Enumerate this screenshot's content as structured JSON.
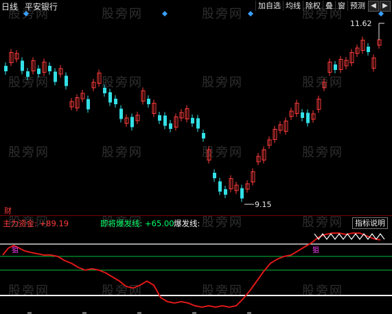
{
  "toolbar": {
    "period": "日线",
    "stock_name": "平安银行",
    "buttons": [
      "加自选",
      "均线",
      "除权",
      "叠",
      "窗",
      "预测"
    ],
    "nav_left": "◀",
    "nav_right": "▶"
  },
  "price_labels": {
    "high": "11.62",
    "low": "9.15"
  },
  "indicator": {
    "side_label": "财",
    "main_fund": "主力资金: +89.19",
    "coming_burst": "即将爆发线: +65.00",
    "burst_line": "爆发线:",
    "explain_button": "指标说明",
    "marker_text": "狙"
  },
  "watermark": "股旁网",
  "colors": {
    "up": "#ff3b3b",
    "down": "#33e0e6",
    "green_line": "#00c040",
    "red_line": "#e01818",
    "white_line": "#ffffff"
  }
}
